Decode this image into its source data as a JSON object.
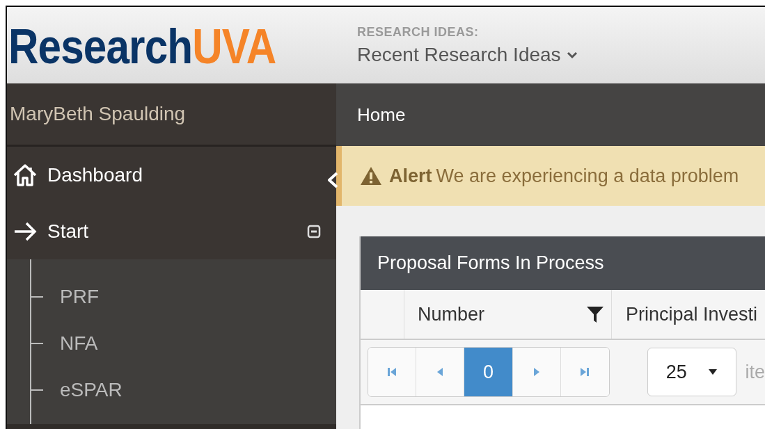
{
  "header": {
    "logo": {
      "part_1": "Research",
      "part_2": "UVA"
    },
    "ideas_label": "RESEARCH IDEAS:",
    "ideas_menu": "Recent Research Ideas"
  },
  "sidebar": {
    "user": "MaryBeth Spaulding",
    "items": [
      {
        "kind": "home",
        "label": "Dashboard"
      },
      {
        "kind": "group",
        "label": "Start",
        "expanded": true,
        "children": [
          {
            "label": "PRF"
          },
          {
            "label": "NFA"
          },
          {
            "label": "eSPAR"
          }
        ]
      }
    ]
  },
  "breadcrumb": "Home",
  "alert": {
    "title": "Alert",
    "message": "We are experiencing a data problem"
  },
  "card": {
    "title": "Proposal Forms In Process",
    "columns": [
      {
        "filter": false
      },
      {
        "label": "Number",
        "filter": true
      },
      {
        "label": "Principal Investi",
        "filter": false
      }
    ],
    "pager": {
      "pages": [
        {
          "label": "0",
          "selected": true
        }
      ],
      "page_size": "25",
      "items_label": "ite"
    }
  }
}
